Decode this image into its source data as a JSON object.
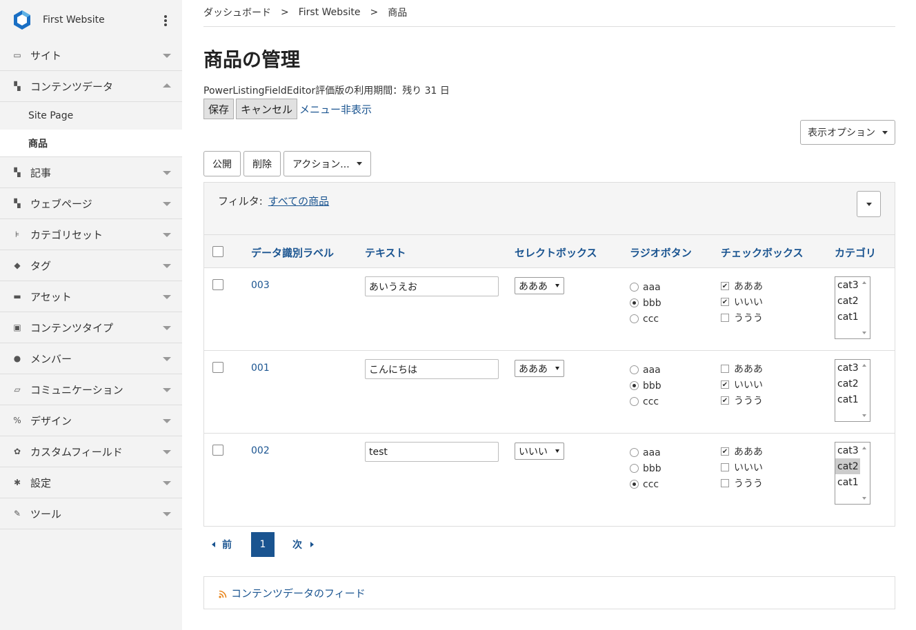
{
  "sidebar": {
    "site_name": "First Website",
    "items": [
      {
        "label": "サイト",
        "icon": "site-icon",
        "expanded": false
      },
      {
        "label": "コンテンツデータ",
        "icon": "content-data-icon",
        "expanded": true,
        "children": [
          {
            "label": "Site Page",
            "active": false
          },
          {
            "label": "商品",
            "active": true
          }
        ]
      },
      {
        "label": "記事",
        "icon": "entry-icon",
        "expanded": false
      },
      {
        "label": "ウェブページ",
        "icon": "webpage-icon",
        "expanded": false
      },
      {
        "label": "カテゴリセット",
        "icon": "category-set-icon",
        "expanded": false
      },
      {
        "label": "タグ",
        "icon": "tag-icon",
        "expanded": false
      },
      {
        "label": "アセット",
        "icon": "asset-icon",
        "expanded": false
      },
      {
        "label": "コンテンツタイプ",
        "icon": "content-type-icon",
        "expanded": false
      },
      {
        "label": "メンバー",
        "icon": "member-icon",
        "expanded": false
      },
      {
        "label": "コミュニケーション",
        "icon": "communication-icon",
        "expanded": false
      },
      {
        "label": "デザイン",
        "icon": "design-icon",
        "expanded": false
      },
      {
        "label": "カスタムフィールド",
        "icon": "custom-field-icon",
        "expanded": false
      },
      {
        "label": "設定",
        "icon": "settings-icon",
        "expanded": false
      },
      {
        "label": "ツール",
        "icon": "tools-icon",
        "expanded": false
      }
    ]
  },
  "breadcrumb": [
    "ダッシュボード",
    "First Website",
    "商品"
  ],
  "breadcrumb_sep": ">",
  "page_title": "商品の管理",
  "notice": "PowerListingFieldEditor評価版の利用期間：残り 31 日",
  "buttons": {
    "save": "保存",
    "cancel": "キャンセル",
    "hide_menu": "メニュー非表示",
    "display_options": "表示オプション"
  },
  "actions": {
    "publish": "公開",
    "delete": "削除",
    "more": "アクション..."
  },
  "filter": {
    "label": "フィルタ:",
    "value": "すべての商品"
  },
  "table": {
    "headers": [
      "データ識別ラベル",
      "テキスト",
      "セレクトボックス",
      "ラジオボタン",
      "チェックボックス",
      "カテゴリ"
    ],
    "radio_options": [
      "aaa",
      "bbb",
      "ccc"
    ],
    "check_options": [
      "あああ",
      "いいい",
      "ううう"
    ],
    "category_options": [
      "cat3",
      "cat2",
      "cat1"
    ],
    "rows": [
      {
        "label": "003",
        "text": "あいうえお",
        "select": "あああ",
        "radio": "bbb",
        "checks": [
          true,
          true,
          false
        ],
        "categories_selected": []
      },
      {
        "label": "001",
        "text": "こんにちは",
        "select": "あああ",
        "radio": "bbb",
        "checks": [
          false,
          true,
          true
        ],
        "categories_selected": []
      },
      {
        "label": "002",
        "text": "test",
        "select": "いいい",
        "radio": "ccc",
        "checks": [
          true,
          false,
          false
        ],
        "categories_selected": [
          "cat2"
        ]
      }
    ]
  },
  "pagination": {
    "prev": "前",
    "current": "1",
    "next": "次"
  },
  "feed": {
    "label": "コンテンツデータのフィード"
  },
  "colors": {
    "link": "#1a5490",
    "accent": "#1a5490",
    "sidebar_bg": "#f3f3f3"
  }
}
